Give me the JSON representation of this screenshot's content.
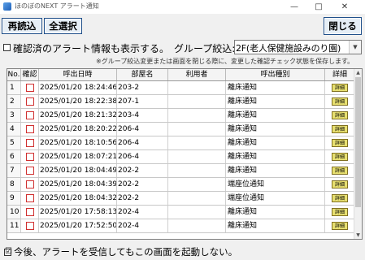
{
  "window": {
    "title": "ほのぼのNEXT アラート通知",
    "minimize_glyph": "—",
    "maximize_glyph": "□",
    "close_glyph": "✕"
  },
  "toolbar": {
    "reload_label": "再読込",
    "select_all_label": "全選択",
    "close_label": "閉じる"
  },
  "options": {
    "show_confirmed_label": "確認済のアラート情報も表示する。",
    "show_confirmed_checked": false,
    "group_filter_label": "グループ絞込:",
    "group_filter_value": "2F(老人保健施設みのり園)",
    "note": "※グループ絞込変更または画面を閉じる際に、変更した確認チェック状態を保存します。"
  },
  "grid": {
    "columns": [
      "No.",
      "確認",
      "呼出日時",
      "部屋名",
      "利用者",
      "呼出種別",
      "詳細"
    ],
    "detail_button_label": "詳細",
    "rows": [
      {
        "no": "1",
        "confirmed": false,
        "time": "2025/01/20 18:24:46",
        "room": "203-2",
        "user": "",
        "type": "離床通知"
      },
      {
        "no": "2",
        "confirmed": false,
        "time": "2025/01/20 18:22:38",
        "room": "207-1",
        "user": "",
        "type": "離床通知"
      },
      {
        "no": "3",
        "confirmed": false,
        "time": "2025/01/20 18:21:32",
        "room": "203-4",
        "user": "",
        "type": "離床通知"
      },
      {
        "no": "4",
        "confirmed": false,
        "time": "2025/01/20 18:20:22",
        "room": "206-4",
        "user": "",
        "type": "離床通知"
      },
      {
        "no": "5",
        "confirmed": false,
        "time": "2025/01/20 18:10:56",
        "room": "206-4",
        "user": "",
        "type": "離床通知"
      },
      {
        "no": "6",
        "confirmed": false,
        "time": "2025/01/20 18:07:21",
        "room": "206-4",
        "user": "",
        "type": "離床通知"
      },
      {
        "no": "7",
        "confirmed": false,
        "time": "2025/01/20 18:04:49",
        "room": "202-2",
        "user": "",
        "type": "離床通知"
      },
      {
        "no": "8",
        "confirmed": false,
        "time": "2025/01/20 18:04:39",
        "room": "202-2",
        "user": "",
        "type": "端座位通知"
      },
      {
        "no": "9",
        "confirmed": false,
        "time": "2025/01/20 18:04:32",
        "room": "202-2",
        "user": "",
        "type": "端座位通知"
      },
      {
        "no": "10",
        "confirmed": false,
        "time": "2025/01/20 17:58:13",
        "room": "202-4",
        "user": "",
        "type": "離床通知"
      },
      {
        "no": "11",
        "confirmed": false,
        "time": "2025/01/20 17:52:50",
        "room": "202-4",
        "user": "",
        "type": "離床通知"
      }
    ]
  },
  "footer": {
    "never_show_label": "今後、アラートを受信してもこの画面を起動しない。",
    "never_show_checked": true,
    "check_glyph": "☑"
  },
  "colors": {
    "confirm_box_border": "#d03030",
    "detail_button_bg": "#e8e070",
    "button_border": "#1f4f8a"
  }
}
